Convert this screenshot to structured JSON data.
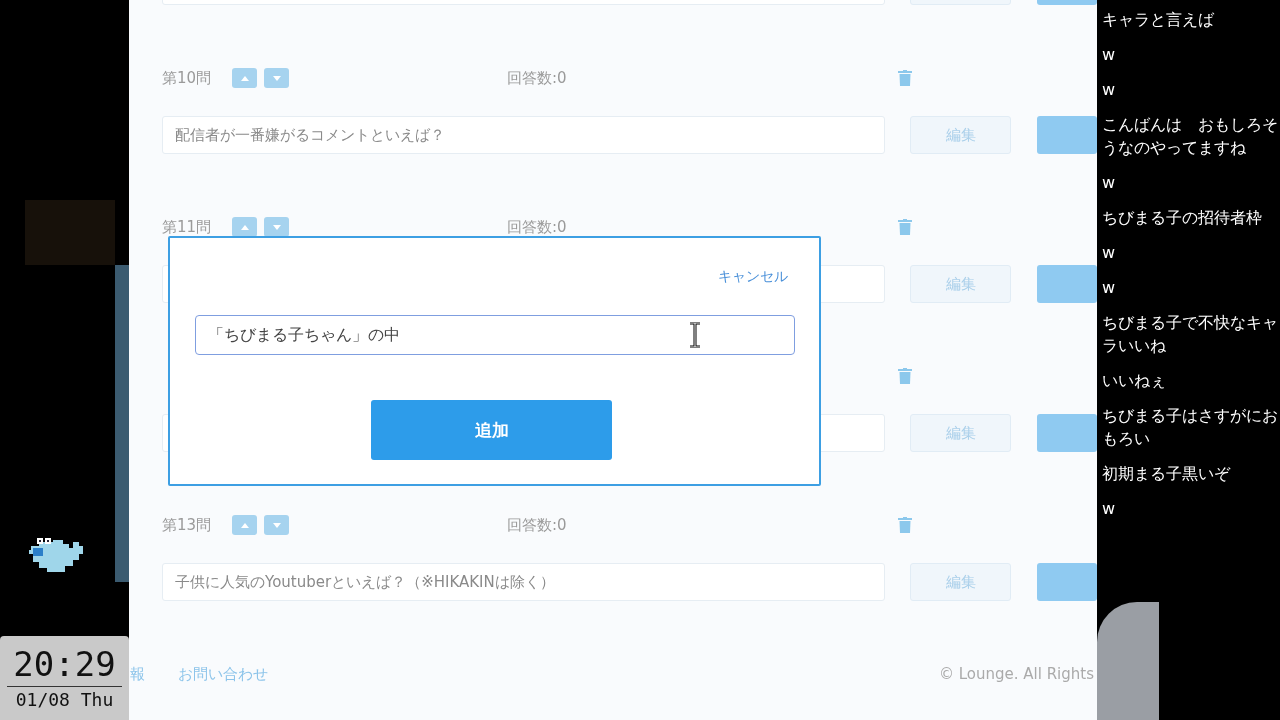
{
  "stream_clock": {
    "time": "20:29",
    "date": "01/08 Thu"
  },
  "questions": [
    {
      "kind": "partial"
    },
    {
      "kind": "question",
      "label": "第10問",
      "answers": "回答数:0",
      "text": "配信者が一番嫌がるコメントといえば？",
      "edit": "編集"
    },
    {
      "kind": "question",
      "label": "第11問",
      "answers": "回答数:0",
      "edit": "編集"
    },
    {
      "kind": "question",
      "edit": "編集"
    },
    {
      "kind": "question",
      "label": "第13問",
      "answers": "回答数:0",
      "text": "子供に人気のYoutuberといえば？（※HIKAKINは除く）",
      "edit": "編集"
    }
  ],
  "footer": {
    "links": [
      "報",
      "お問い合わせ"
    ],
    "copyright": "© Lounge. All Rights"
  },
  "dialog": {
    "cancel": "キャンセル",
    "value": "「ちびまる子ちゃん」の中",
    "submit": "追加"
  },
  "chat": [
    "キャラと言えば",
    "w",
    "w",
    "こんばんは　おもしろそうなのやってますね",
    "w",
    "ちびまる子の招待者枠",
    "w",
    "w",
    "ちびまる子で不快なキャラいいね",
    "いいねぇ",
    "ちびまる子はさすがにおもろい",
    "初期まる子黒いぞ",
    "w"
  ]
}
